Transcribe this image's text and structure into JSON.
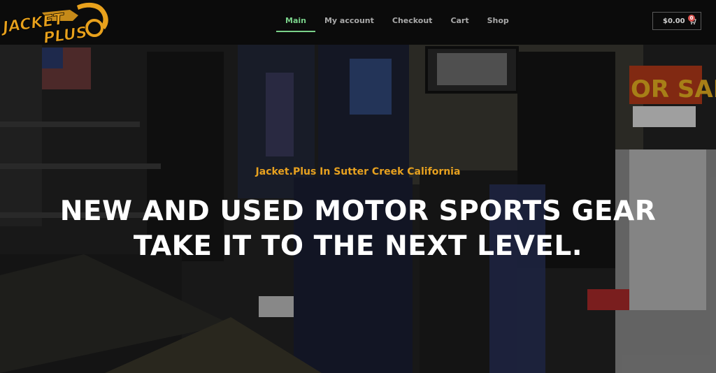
{
  "brand": {
    "logo_text_line1": "JACKET",
    "logo_text_line2": "PLUS",
    "accent": "#e8a11c"
  },
  "nav": {
    "items": [
      {
        "label": "Main",
        "active": true
      },
      {
        "label": "My account",
        "active": false
      },
      {
        "label": "Checkout",
        "active": false
      },
      {
        "label": "Cart",
        "active": false
      },
      {
        "label": "Shop",
        "active": false
      }
    ],
    "active_color": "#7ad18a"
  },
  "cart": {
    "total": "$0.00",
    "count": "0",
    "icon": "cart-icon"
  },
  "hero": {
    "subtitle": "Jacket.Plus In Sutter Creek California",
    "title_line1": "NEW AND USED MOTOR SPORTS GEAR",
    "title_line2": "TAKE IT TO THE NEXT LEVEL."
  }
}
